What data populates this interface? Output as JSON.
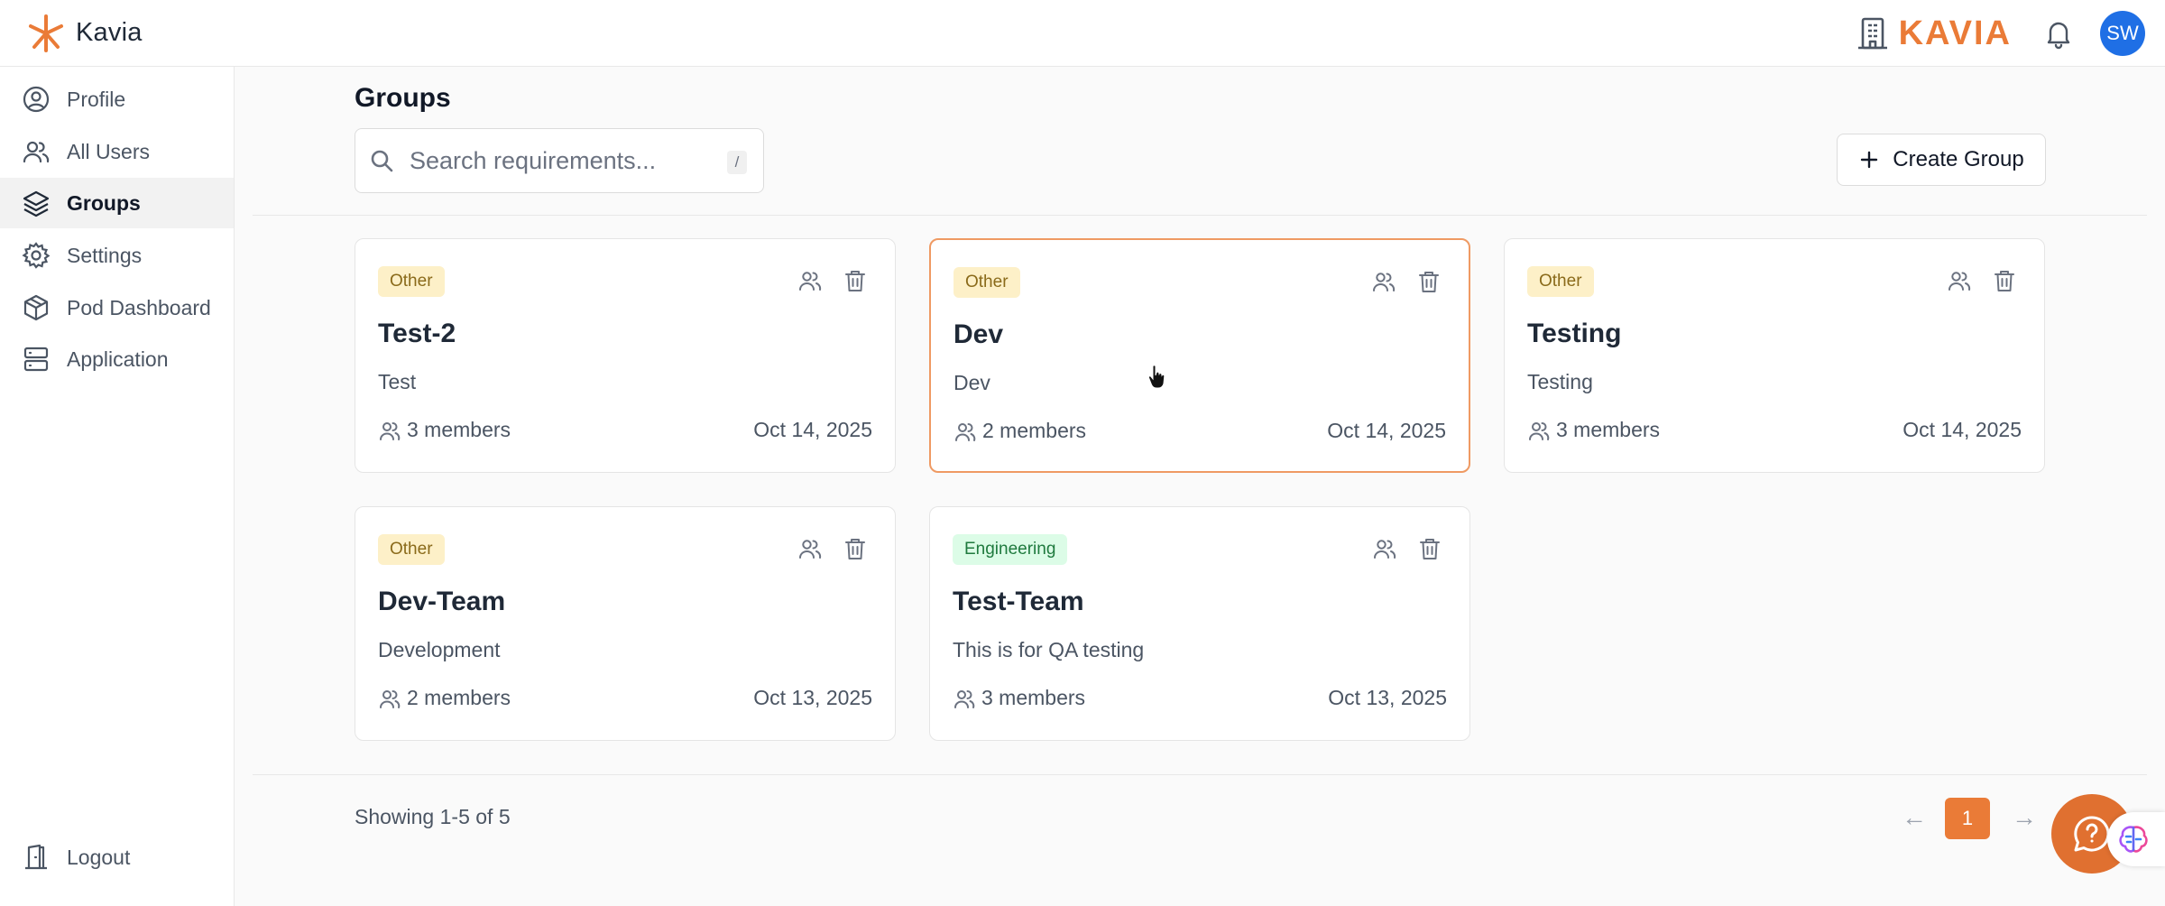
{
  "header": {
    "brand_name": "Kavia",
    "logo_word": "KAVIA",
    "avatar_initials": "SW"
  },
  "sidebar": {
    "items": [
      {
        "label": "Profile",
        "icon": "user-circle-icon"
      },
      {
        "label": "All Users",
        "icon": "users-icon"
      },
      {
        "label": "Groups",
        "icon": "layers-icon",
        "active": true
      },
      {
        "label": "Settings",
        "icon": "gear-icon"
      },
      {
        "label": "Pod Dashboard",
        "icon": "cube-icon"
      },
      {
        "label": "Application",
        "icon": "server-icon"
      }
    ],
    "logout_label": "Logout"
  },
  "main": {
    "title": "Groups",
    "search": {
      "placeholder": "Search requirements...",
      "value": "",
      "shortcut": "/"
    },
    "create_label": "Create Group"
  },
  "groups": [
    {
      "category": "Other",
      "name": "Test-2",
      "description": "Test",
      "members": "3 members",
      "date": "Oct 14, 2025"
    },
    {
      "category": "Other",
      "name": "Dev",
      "description": "Dev",
      "members": "2 members",
      "date": "Oct 14, 2025"
    },
    {
      "category": "Other",
      "name": "Testing",
      "description": "Testing",
      "members": "3 members",
      "date": "Oct 14, 2025"
    },
    {
      "category": "Other",
      "name": "Dev-Team",
      "description": "Development",
      "members": "2 members",
      "date": "Oct 13, 2025"
    },
    {
      "category": "Engineering",
      "name": "Test-Team",
      "description": "This is for QA testing",
      "members": "3 members",
      "date": "Oct 13, 2025"
    }
  ],
  "pagination": {
    "summary": "Showing 1-5 of 5",
    "prev": "←",
    "current_page": "1",
    "next": "→"
  },
  "colors": {
    "accent": "#ea7b37",
    "avatar": "#1f6fe5",
    "badge_other": "#fdf0c8",
    "badge_engineering": "#dcfce7"
  }
}
